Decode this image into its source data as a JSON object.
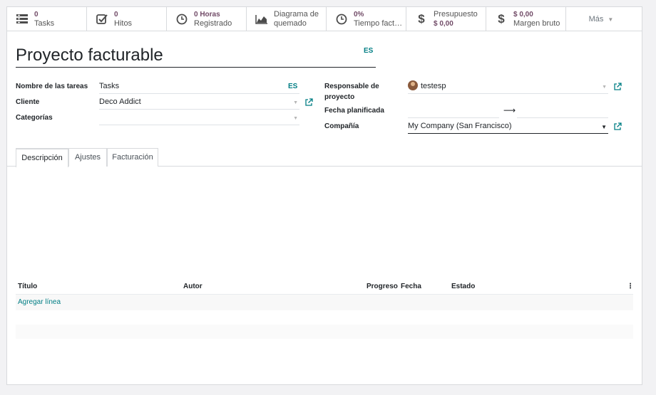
{
  "smart_buttons": [
    {
      "icon": "tasks-icon",
      "value": "0",
      "label": "Tasks"
    },
    {
      "icon": "check-square-icon",
      "value": "0",
      "label": "Hitos"
    },
    {
      "icon": "clock-icon",
      "value": "0 Horas",
      "label": "Registrado"
    },
    {
      "icon": "area-chart-icon",
      "value": "Diagrama de",
      "label": "quemado"
    },
    {
      "icon": "clock-icon",
      "value": "0%",
      "label": "Tiempo factu..."
    },
    {
      "icon": "dollar-icon",
      "value": "Presupuesto",
      "label": "$ 0,00"
    },
    {
      "icon": "dollar-icon",
      "value": "$ 0,00",
      "label": "Margen bruto"
    }
  ],
  "more_label": "Más",
  "project": {
    "title": "Proyecto facturable",
    "title_lang": "ES"
  },
  "left_fields": {
    "task_name_label": "Nombre de las tareas",
    "task_name_value": "Tasks",
    "task_name_lang": "ES",
    "customer_label": "Cliente",
    "customer_value": "Deco Addict",
    "tags_label": "Categorías",
    "tags_value": ""
  },
  "right_fields": {
    "manager_label_1": "Responsable de",
    "manager_label_2": "proyecto",
    "manager_value": "testesp",
    "planned_date_label": "Fecha planificada",
    "date_arrow": "⟶",
    "company_label": "Compañía",
    "company_value": "My Company (San Francisco)"
  },
  "tabs": [
    {
      "label": "Descripción",
      "active": true
    },
    {
      "label": "Ajustes",
      "active": false
    },
    {
      "label": "Facturación",
      "active": false
    }
  ],
  "table": {
    "columns": [
      "Título",
      "Autor",
      "Progreso",
      "Fecha",
      "Estado"
    ],
    "add_line": "Agregar línea"
  },
  "colors": {
    "accent": "#017e84",
    "brand": "#714b67"
  }
}
